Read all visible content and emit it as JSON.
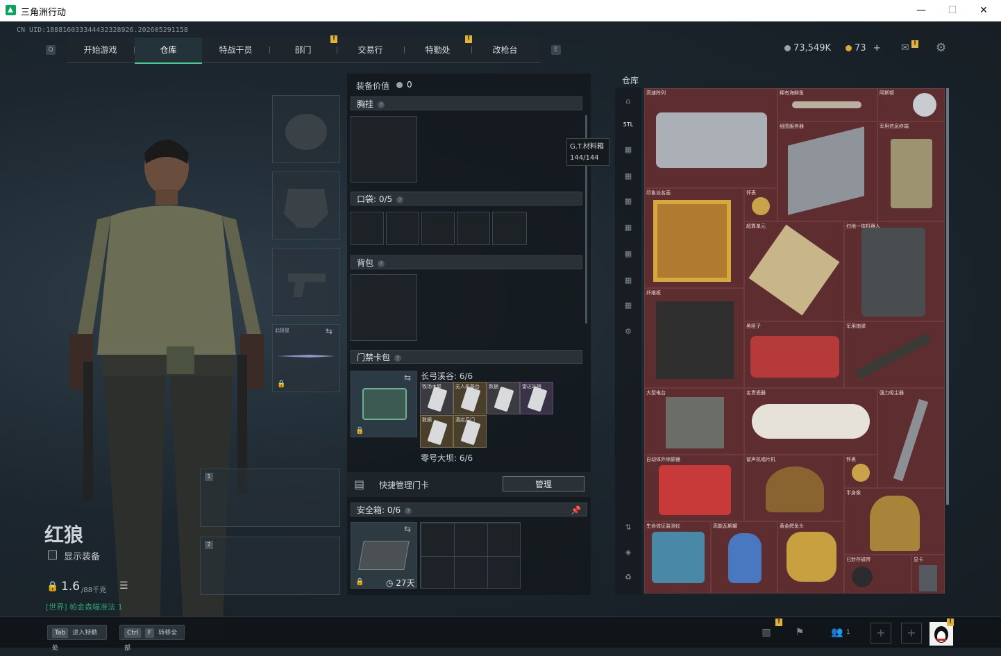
{
  "window": {
    "title": "三角洲行动",
    "minimize": "—",
    "maximize": "☐",
    "close": "✕"
  },
  "uid": "CN UID:188816033344432328926.202605291158",
  "nav": {
    "left_key": "Q",
    "right_key": "E",
    "tabs": [
      "开始游戏",
      "仓库",
      "特战干员",
      "部门",
      "交易行",
      "特勤处",
      "改枪台"
    ],
    "alerts": [
      "!",
      "!"
    ]
  },
  "currency": {
    "silver": "73,549K",
    "gold": "73",
    "plus": "+"
  },
  "operator": {
    "name": "红狼",
    "show_gear_label": "显示装备",
    "weight": "1.6",
    "weight_max": "/88千克",
    "chat": "[世界] 帕金森喵准法 1"
  },
  "gear_slots": {
    "melee_label": "北极星",
    "weapon1": "1",
    "weapon2": "2"
  },
  "equip": {
    "value_label": "装备价值",
    "value": "0",
    "chest_rig": "胸挂",
    "pocket": "口袋: 0/5",
    "backpack": "背包",
    "keycard_bag": "门禁卡包",
    "map1": "长弓溪谷: 6/6",
    "map1_cards": [
      "牧场木屋",
      "无人机基台",
      "数据",
      "雷达站宿"
    ],
    "map1_cards_row2": [
      "数据",
      "酒店后门"
    ],
    "map2": "零号大坝: 6/6",
    "quick_manage": "快捷管理门卡",
    "manage_btn": "管理",
    "safe_box": "安全箱: 0/6",
    "safe_time": "27天",
    "tooltip_name": "G.T.材料箱",
    "tooltip_count": "144/144"
  },
  "warehouse": {
    "title": "仓库",
    "items": [
      "高速阵列",
      "稀有海鲜鱼",
      "阿斯顿",
      "组图服务器",
      "军用信息终端",
      "印象派名画",
      "怀表",
      "超算单元",
      "扫地一体机器人",
      "纤维板",
      "黑匣子",
      "军用炮弹",
      "大型电台",
      "名贵瓷器",
      "强力吸尘器",
      "自动体外除颤器",
      "留声机唱片机",
      "怀表",
      "半身像",
      "生命体征监测仪",
      "高能瓦斯罐",
      "黄金鳄鱼头",
      "已封存磁带",
      "显卡"
    ]
  },
  "bottom": {
    "tab_key": "Tab",
    "tab_label": "进入特勤处",
    "ctrl_key": "Ctrl",
    "f_key": "F",
    "transfer_label": "转移全部",
    "friends_count": "1",
    "alert": "!"
  }
}
